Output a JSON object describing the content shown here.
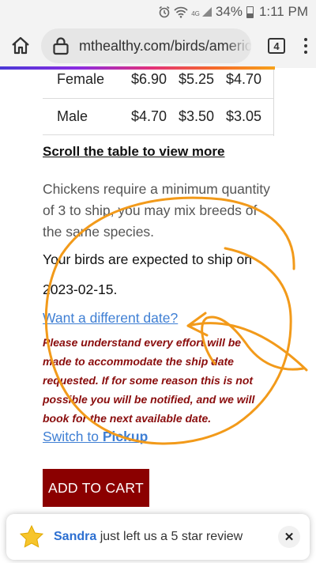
{
  "status_bar": {
    "signal_label": "4G",
    "battery": "34%",
    "time": "1:11 PM"
  },
  "browser": {
    "url": "mthealthy.com/birds/american",
    "tab_count": "4",
    "loading_progress": 0.87
  },
  "price_table": {
    "rows": [
      {
        "gender": "Female",
        "prices": [
          "$6.90",
          "$5.25",
          "$4.70"
        ]
      },
      {
        "gender": "Male",
        "prices": [
          "$4.70",
          "$3.50",
          "$3.05"
        ]
      }
    ]
  },
  "scroll_note": "Scroll the table to view more",
  "ship_note": "Chickens require a minimum quantity of 3 to ship, you may mix breeds of the same species.",
  "ship_date_text": "Your birds are expected to ship on",
  "ship_date": "2023-02-15.",
  "want_different_date": "Want a different date?",
  "disclaimer": "Please understand every effort will be made to accommodate the ship date requested. If for some reason this is not possible you will be notified, and we will book for the next available date.",
  "switch_prefix": "Switch to ",
  "switch_pickup": "Pickup",
  "add_to_cart": "ADD TO CART",
  "toast": {
    "name": "Sandra",
    "message": " just left us a 5 star review"
  },
  "colors": {
    "cart_button": "#8b0000",
    "link": "#3f7fd4",
    "disclaimer": "#8a0d0d",
    "annotation": "#f29a1a",
    "star": "#f7c52b"
  },
  "icons": [
    "alarm-icon",
    "wifi-icon",
    "signal-icon",
    "battery-icon",
    "home-icon",
    "lock-icon",
    "tabs-icon",
    "overflow-menu-icon",
    "star-icon",
    "close-icon"
  ]
}
